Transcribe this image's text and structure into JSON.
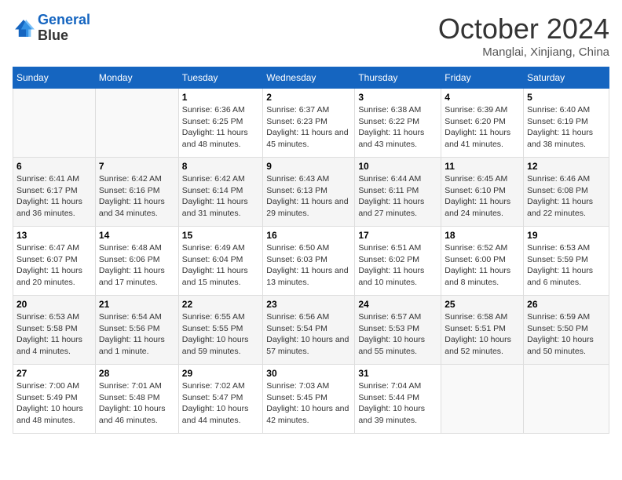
{
  "header": {
    "logo_line1": "General",
    "logo_line2": "Blue",
    "month": "October 2024",
    "location": "Manglai, Xinjiang, China"
  },
  "weekdays": [
    "Sunday",
    "Monday",
    "Tuesday",
    "Wednesday",
    "Thursday",
    "Friday",
    "Saturday"
  ],
  "weeks": [
    [
      {
        "day": "",
        "sunrise": "",
        "sunset": "",
        "daylight": ""
      },
      {
        "day": "",
        "sunrise": "",
        "sunset": "",
        "daylight": ""
      },
      {
        "day": "1",
        "sunrise": "Sunrise: 6:36 AM",
        "sunset": "Sunset: 6:25 PM",
        "daylight": "Daylight: 11 hours and 48 minutes."
      },
      {
        "day": "2",
        "sunrise": "Sunrise: 6:37 AM",
        "sunset": "Sunset: 6:23 PM",
        "daylight": "Daylight: 11 hours and 45 minutes."
      },
      {
        "day": "3",
        "sunrise": "Sunrise: 6:38 AM",
        "sunset": "Sunset: 6:22 PM",
        "daylight": "Daylight: 11 hours and 43 minutes."
      },
      {
        "day": "4",
        "sunrise": "Sunrise: 6:39 AM",
        "sunset": "Sunset: 6:20 PM",
        "daylight": "Daylight: 11 hours and 41 minutes."
      },
      {
        "day": "5",
        "sunrise": "Sunrise: 6:40 AM",
        "sunset": "Sunset: 6:19 PM",
        "daylight": "Daylight: 11 hours and 38 minutes."
      }
    ],
    [
      {
        "day": "6",
        "sunrise": "Sunrise: 6:41 AM",
        "sunset": "Sunset: 6:17 PM",
        "daylight": "Daylight: 11 hours and 36 minutes."
      },
      {
        "day": "7",
        "sunrise": "Sunrise: 6:42 AM",
        "sunset": "Sunset: 6:16 PM",
        "daylight": "Daylight: 11 hours and 34 minutes."
      },
      {
        "day": "8",
        "sunrise": "Sunrise: 6:42 AM",
        "sunset": "Sunset: 6:14 PM",
        "daylight": "Daylight: 11 hours and 31 minutes."
      },
      {
        "day": "9",
        "sunrise": "Sunrise: 6:43 AM",
        "sunset": "Sunset: 6:13 PM",
        "daylight": "Daylight: 11 hours and 29 minutes."
      },
      {
        "day": "10",
        "sunrise": "Sunrise: 6:44 AM",
        "sunset": "Sunset: 6:11 PM",
        "daylight": "Daylight: 11 hours and 27 minutes."
      },
      {
        "day": "11",
        "sunrise": "Sunrise: 6:45 AM",
        "sunset": "Sunset: 6:10 PM",
        "daylight": "Daylight: 11 hours and 24 minutes."
      },
      {
        "day": "12",
        "sunrise": "Sunrise: 6:46 AM",
        "sunset": "Sunset: 6:08 PM",
        "daylight": "Daylight: 11 hours and 22 minutes."
      }
    ],
    [
      {
        "day": "13",
        "sunrise": "Sunrise: 6:47 AM",
        "sunset": "Sunset: 6:07 PM",
        "daylight": "Daylight: 11 hours and 20 minutes."
      },
      {
        "day": "14",
        "sunrise": "Sunrise: 6:48 AM",
        "sunset": "Sunset: 6:06 PM",
        "daylight": "Daylight: 11 hours and 17 minutes."
      },
      {
        "day": "15",
        "sunrise": "Sunrise: 6:49 AM",
        "sunset": "Sunset: 6:04 PM",
        "daylight": "Daylight: 11 hours and 15 minutes."
      },
      {
        "day": "16",
        "sunrise": "Sunrise: 6:50 AM",
        "sunset": "Sunset: 6:03 PM",
        "daylight": "Daylight: 11 hours and 13 minutes."
      },
      {
        "day": "17",
        "sunrise": "Sunrise: 6:51 AM",
        "sunset": "Sunset: 6:02 PM",
        "daylight": "Daylight: 11 hours and 10 minutes."
      },
      {
        "day": "18",
        "sunrise": "Sunrise: 6:52 AM",
        "sunset": "Sunset: 6:00 PM",
        "daylight": "Daylight: 11 hours and 8 minutes."
      },
      {
        "day": "19",
        "sunrise": "Sunrise: 6:53 AM",
        "sunset": "Sunset: 5:59 PM",
        "daylight": "Daylight: 11 hours and 6 minutes."
      }
    ],
    [
      {
        "day": "20",
        "sunrise": "Sunrise: 6:53 AM",
        "sunset": "Sunset: 5:58 PM",
        "daylight": "Daylight: 11 hours and 4 minutes."
      },
      {
        "day": "21",
        "sunrise": "Sunrise: 6:54 AM",
        "sunset": "Sunset: 5:56 PM",
        "daylight": "Daylight: 11 hours and 1 minute."
      },
      {
        "day": "22",
        "sunrise": "Sunrise: 6:55 AM",
        "sunset": "Sunset: 5:55 PM",
        "daylight": "Daylight: 10 hours and 59 minutes."
      },
      {
        "day": "23",
        "sunrise": "Sunrise: 6:56 AM",
        "sunset": "Sunset: 5:54 PM",
        "daylight": "Daylight: 10 hours and 57 minutes."
      },
      {
        "day": "24",
        "sunrise": "Sunrise: 6:57 AM",
        "sunset": "Sunset: 5:53 PM",
        "daylight": "Daylight: 10 hours and 55 minutes."
      },
      {
        "day": "25",
        "sunrise": "Sunrise: 6:58 AM",
        "sunset": "Sunset: 5:51 PM",
        "daylight": "Daylight: 10 hours and 52 minutes."
      },
      {
        "day": "26",
        "sunrise": "Sunrise: 6:59 AM",
        "sunset": "Sunset: 5:50 PM",
        "daylight": "Daylight: 10 hours and 50 minutes."
      }
    ],
    [
      {
        "day": "27",
        "sunrise": "Sunrise: 7:00 AM",
        "sunset": "Sunset: 5:49 PM",
        "daylight": "Daylight: 10 hours and 48 minutes."
      },
      {
        "day": "28",
        "sunrise": "Sunrise: 7:01 AM",
        "sunset": "Sunset: 5:48 PM",
        "daylight": "Daylight: 10 hours and 46 minutes."
      },
      {
        "day": "29",
        "sunrise": "Sunrise: 7:02 AM",
        "sunset": "Sunset: 5:47 PM",
        "daylight": "Daylight: 10 hours and 44 minutes."
      },
      {
        "day": "30",
        "sunrise": "Sunrise: 7:03 AM",
        "sunset": "Sunset: 5:45 PM",
        "daylight": "Daylight: 10 hours and 42 minutes."
      },
      {
        "day": "31",
        "sunrise": "Sunrise: 7:04 AM",
        "sunset": "Sunset: 5:44 PM",
        "daylight": "Daylight: 10 hours and 39 minutes."
      },
      {
        "day": "",
        "sunrise": "",
        "sunset": "",
        "daylight": ""
      },
      {
        "day": "",
        "sunrise": "",
        "sunset": "",
        "daylight": ""
      }
    ]
  ]
}
